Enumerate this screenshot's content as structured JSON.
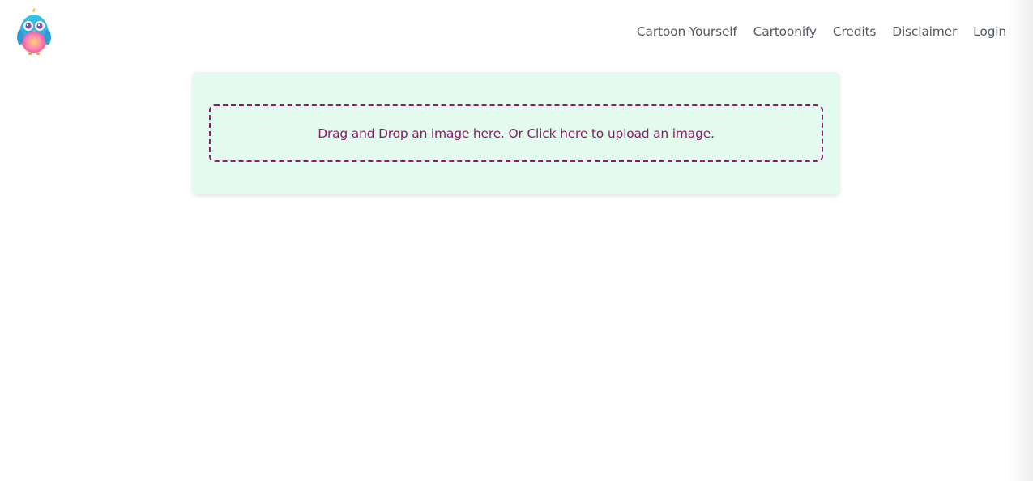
{
  "header": {
    "logo_icon": "owl-bird-mascot-icon",
    "nav": [
      {
        "label": "Cartoon Yourself"
      },
      {
        "label": "Cartoonify"
      },
      {
        "label": "Credits"
      },
      {
        "label": "Disclaimer"
      },
      {
        "label": "Login"
      }
    ]
  },
  "upload": {
    "prompt": "Drag and Drop an image here. Or Click here to upload an image."
  },
  "colors": {
    "card_background": "#e3fbee",
    "dropzone_accent": "#8b1d6b",
    "nav_text": "#555a60"
  }
}
